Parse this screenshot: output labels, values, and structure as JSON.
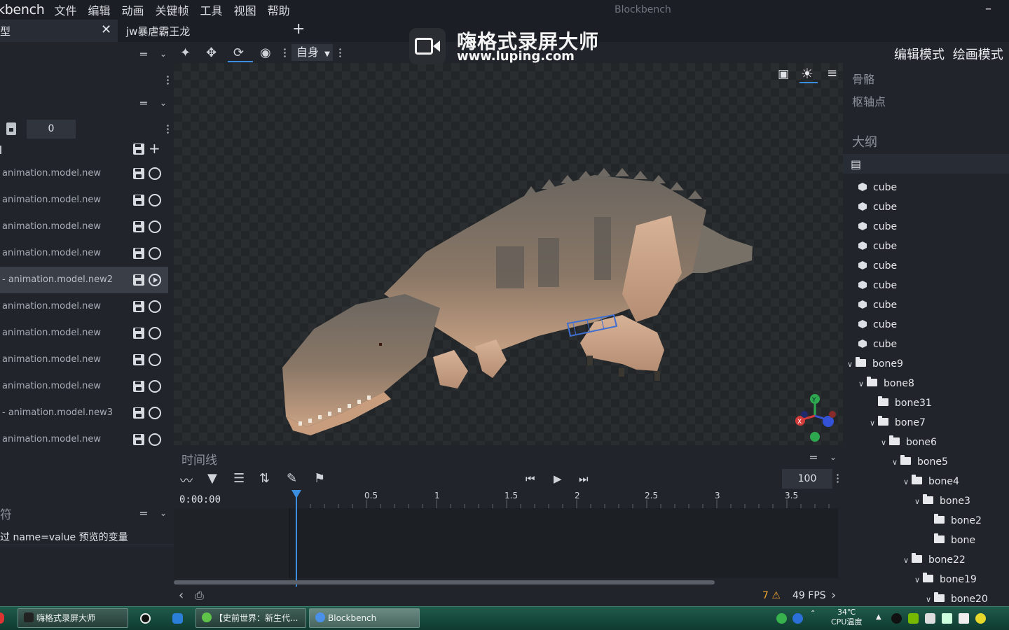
{
  "app": {
    "brand": "kbench",
    "window_title": "Blockbench",
    "menu": [
      "文件",
      "编辑",
      "动画",
      "关键帧",
      "工具",
      "视图",
      "帮助"
    ],
    "minimize": "–"
  },
  "tabs": {
    "model_tab": "型",
    "model_close": "✕",
    "project_tab": "jw暴虐霸王龙",
    "add": "+"
  },
  "toolbar": {
    "space_select": "自身",
    "modes": [
      "编辑模式",
      "绘画模式"
    ]
  },
  "left_panel": {
    "frame_value": "0",
    "animations": [
      {
        "name": "animation.model.new",
        "state": "idle"
      },
      {
        "name": "animation.model.new",
        "state": "idle"
      },
      {
        "name": "animation.model.new",
        "state": "idle"
      },
      {
        "name": "animation.model.new",
        "state": "idle"
      },
      {
        "name": "- animation.model.new2",
        "state": "playing"
      },
      {
        "name": "animation.model.new",
        "state": "idle"
      },
      {
        "name": "animation.model.new",
        "state": "idle"
      },
      {
        "name": "animation.model.new",
        "state": "idle"
      },
      {
        "name": "animation.model.new",
        "state": "idle"
      },
      {
        "name": "- animation.model.new3",
        "state": "idle"
      },
      {
        "name": "animation.model.new",
        "state": "idle"
      }
    ],
    "variable_title": "符",
    "variable_hint": "过 name=value 预览的变量"
  },
  "timeline": {
    "title": "时间线",
    "time": "0:00:00",
    "speed": "100",
    "ruler_ticks": [
      "0.5",
      "1",
      "1.5",
      "2",
      "2.5",
      "3",
      "3.5"
    ],
    "warnings": "7",
    "fps": "49 FPS"
  },
  "right_panel": {
    "bone_title": "骨骼",
    "pivot_title": "枢轴点",
    "outline_title": "大纲",
    "outline": [
      {
        "label": "cube",
        "type": "cube",
        "depth": 0,
        "expanded": false
      },
      {
        "label": "cube",
        "type": "cube",
        "depth": 0,
        "expanded": false
      },
      {
        "label": "cube",
        "type": "cube",
        "depth": 0,
        "expanded": false
      },
      {
        "label": "cube",
        "type": "cube",
        "depth": 0,
        "expanded": false
      },
      {
        "label": "cube",
        "type": "cube",
        "depth": 0,
        "expanded": false
      },
      {
        "label": "cube",
        "type": "cube",
        "depth": 0,
        "expanded": false
      },
      {
        "label": "cube",
        "type": "cube",
        "depth": 0,
        "expanded": false
      },
      {
        "label": "cube",
        "type": "cube",
        "depth": 0,
        "expanded": false
      },
      {
        "label": "cube",
        "type": "cube",
        "depth": 0,
        "expanded": false
      },
      {
        "label": "bone9",
        "type": "group",
        "depth": 0,
        "expanded": true
      },
      {
        "label": "bone8",
        "type": "group",
        "depth": 1,
        "expanded": true
      },
      {
        "label": "bone31",
        "type": "group",
        "depth": 2,
        "expanded": false
      },
      {
        "label": "bone7",
        "type": "group",
        "depth": 2,
        "expanded": true
      },
      {
        "label": "bone6",
        "type": "group",
        "depth": 3,
        "expanded": true
      },
      {
        "label": "bone5",
        "type": "group",
        "depth": 4,
        "expanded": true
      },
      {
        "label": "bone4",
        "type": "group",
        "depth": 5,
        "expanded": true
      },
      {
        "label": "bone3",
        "type": "group",
        "depth": 6,
        "expanded": true
      },
      {
        "label": "bone2",
        "type": "group",
        "depth": 7,
        "expanded": false
      },
      {
        "label": "bone",
        "type": "group",
        "depth": 7,
        "expanded": false
      },
      {
        "label": "bone22",
        "type": "group",
        "depth": 5,
        "expanded": true
      },
      {
        "label": "bone19",
        "type": "group",
        "depth": 6,
        "expanded": true
      },
      {
        "label": "bone20",
        "type": "group",
        "depth": 7,
        "expanded": true
      }
    ]
  },
  "watermark": {
    "name": "嗨格式录屏大师",
    "url": "www.luping.com"
  },
  "taskbar": {
    "tasks": [
      "嗨格式录屏大师",
      "【史前世界：新生代...",
      "Blockbench"
    ],
    "temp": "34℃",
    "temp_label": "CPU温度"
  },
  "colors": {
    "accent": "#3c8fe0",
    "warning": "#f0a62e",
    "playhead": "#3c8fe0",
    "taskbar": "#1f5a4a"
  }
}
